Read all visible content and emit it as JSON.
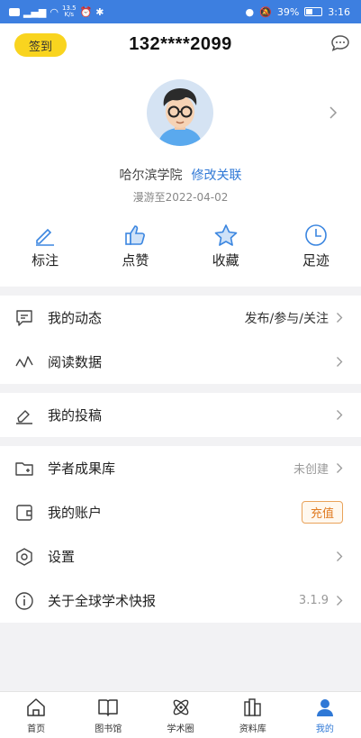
{
  "status": {
    "speed_top": "13.5",
    "speed_unit": "K/s",
    "battery": "39%",
    "time": "3:16"
  },
  "header": {
    "checkin_label": "签到",
    "phone": "132****2099"
  },
  "profile": {
    "school": "哈尔滨学院",
    "edit_label": "修改关联",
    "roam": "漫游至2022-04-02"
  },
  "quick": [
    {
      "label": "标注"
    },
    {
      "label": "点赞"
    },
    {
      "label": "收藏"
    },
    {
      "label": "足迹"
    }
  ],
  "menu": {
    "dynamics": {
      "title": "我的动态",
      "value": "发布/参与/关注"
    },
    "reading": {
      "title": "阅读数据"
    },
    "submission": {
      "title": "我的投稿"
    },
    "scholar": {
      "title": "学者成果库",
      "value": "未创建"
    },
    "account": {
      "title": "我的账户",
      "button": "充值"
    },
    "settings": {
      "title": "设置"
    },
    "about": {
      "title": "关于全球学术快报",
      "value": "3.1.9"
    }
  },
  "tabs": [
    {
      "label": "首页"
    },
    {
      "label": "图书馆"
    },
    {
      "label": "学术圈"
    },
    {
      "label": "资料库"
    },
    {
      "label": "我的"
    }
  ],
  "colors": {
    "accent": "#2f78d6",
    "checkin": "#f9d41f",
    "statusbar": "#3d7fe0",
    "recharge": "#e07b22"
  }
}
